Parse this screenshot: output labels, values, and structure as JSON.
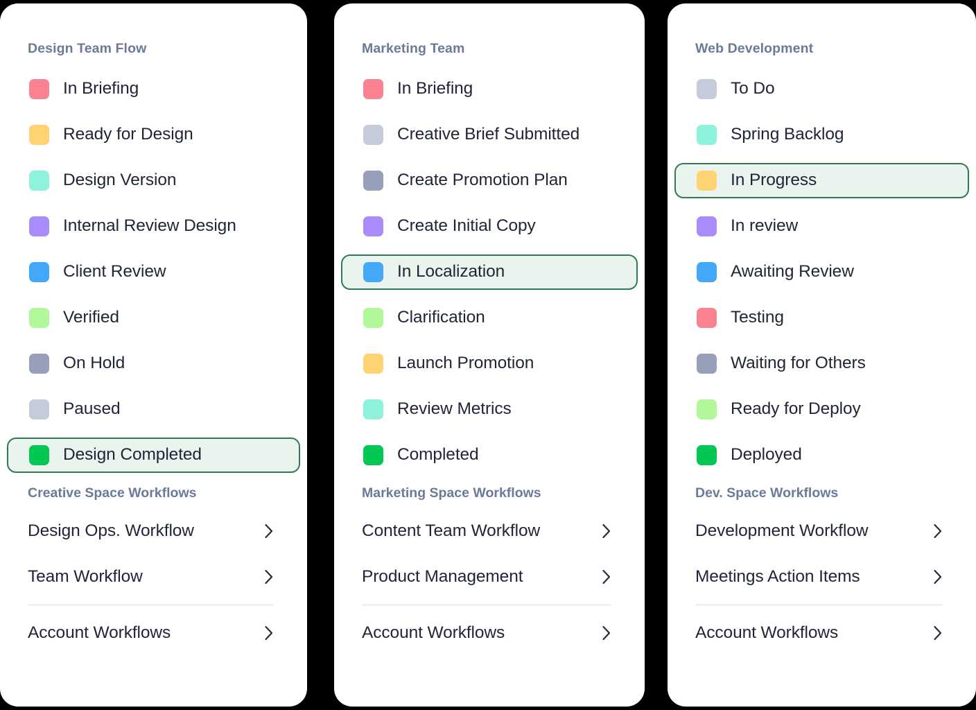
{
  "background_color": "#000000",
  "panel_background": "#ffffff",
  "accent": {
    "header_text": "#6b7a99",
    "body_text": "#1f2536",
    "selected_border": "#2f7a52",
    "selected_background": "#eaf4ef",
    "divider": "#f0f1f3"
  },
  "panels": [
    {
      "title": "Design Team Flow",
      "statuses": [
        {
          "label": "In Briefing",
          "color": "#fb8290",
          "selected": false
        },
        {
          "label": "Ready for Design",
          "color": "#ffd372",
          "selected": false
        },
        {
          "label": "Design Version",
          "color": "#8ef2dc",
          "selected": false
        },
        {
          "label": "Internal Review Design",
          "color": "#a98bfa",
          "selected": false
        },
        {
          "label": "Client Review",
          "color": "#44a8f8",
          "selected": false
        },
        {
          "label": "Verified",
          "color": "#b3f79b",
          "selected": false
        },
        {
          "label": "On Hold",
          "color": "#97a0b8",
          "selected": false
        },
        {
          "label": "Paused",
          "color": "#c6cbdb",
          "selected": false
        },
        {
          "label": "Design Completed",
          "color": "#00c853",
          "selected": true
        }
      ],
      "workflows_title": "Creative Space Workflows",
      "workflow_links": [
        {
          "label": "Design Ops. Workflow",
          "icon": "chevron-right-icon"
        },
        {
          "label": "Team Workflow",
          "icon": "chevron-right-icon"
        }
      ],
      "account_link": {
        "label": "Account Workflows",
        "icon": "chevron-right-icon"
      }
    },
    {
      "title": "Marketing Team",
      "statuses": [
        {
          "label": "In Briefing",
          "color": "#fb8290",
          "selected": false
        },
        {
          "label": "Creative Brief Submitted",
          "color": "#c6cbdb",
          "selected": false
        },
        {
          "label": "Create Promotion Plan",
          "color": "#97a0b8",
          "selected": false
        },
        {
          "label": "Create Initial Copy",
          "color": "#a98bfa",
          "selected": false
        },
        {
          "label": "In Localization",
          "color": "#44a8f8",
          "selected": true
        },
        {
          "label": "Clarification",
          "color": "#b3f79b",
          "selected": false
        },
        {
          "label": "Launch Promotion",
          "color": "#ffd372",
          "selected": false
        },
        {
          "label": "Review Metrics",
          "color": "#8ef2dc",
          "selected": false
        },
        {
          "label": "Completed",
          "color": "#00c853",
          "selected": false
        }
      ],
      "workflows_title": "Marketing Space Workflows",
      "workflow_links": [
        {
          "label": "Content Team Workflow",
          "icon": "chevron-right-icon"
        },
        {
          "label": "Product Management",
          "icon": "chevron-right-icon"
        }
      ],
      "account_link": {
        "label": "Account Workflows",
        "icon": "chevron-right-icon"
      }
    },
    {
      "title": "Web Development",
      "statuses": [
        {
          "label": "To Do",
          "color": "#c6cbdb",
          "selected": false
        },
        {
          "label": "Spring Backlog",
          "color": "#8ef2dc",
          "selected": false
        },
        {
          "label": "In Progress",
          "color": "#ffd372",
          "selected": true
        },
        {
          "label": "In review",
          "color": "#a98bfa",
          "selected": false
        },
        {
          "label": "Awaiting Review",
          "color": "#44a8f8",
          "selected": false
        },
        {
          "label": "Testing",
          "color": "#fb8290",
          "selected": false
        },
        {
          "label": "Waiting for Others",
          "color": "#97a0b8",
          "selected": false
        },
        {
          "label": "Ready for Deploy",
          "color": "#b3f79b",
          "selected": false
        },
        {
          "label": "Deployed",
          "color": "#00c853",
          "selected": false
        }
      ],
      "workflows_title": "Dev. Space Workflows",
      "workflow_links": [
        {
          "label": "Development Workflow",
          "icon": "chevron-right-icon"
        },
        {
          "label": "Meetings Action Items",
          "icon": "chevron-right-icon"
        }
      ],
      "account_link": {
        "label": "Account Workflows",
        "icon": "chevron-right-icon"
      }
    }
  ]
}
